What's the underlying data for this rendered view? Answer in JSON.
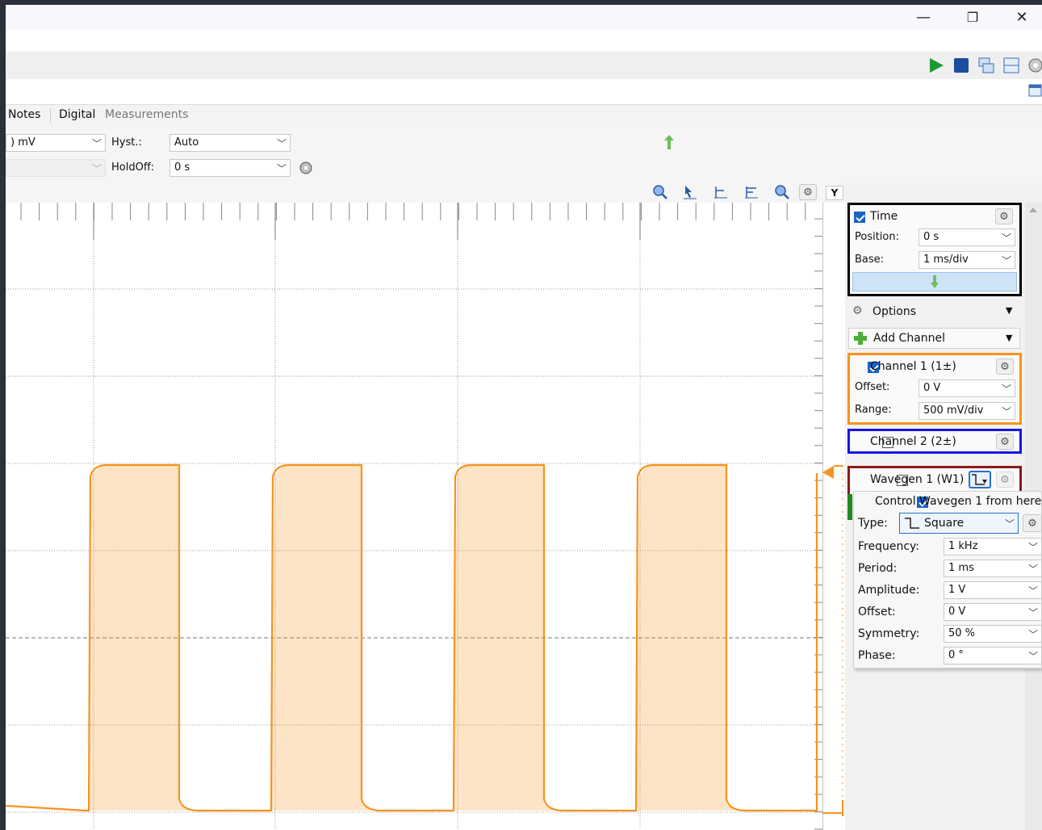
{
  "window": {
    "minimize_glyph": "—",
    "restore_glyph": "❐",
    "close_glyph": "✕"
  },
  "tabs": [
    {
      "label": "Notes",
      "active": true
    },
    {
      "label": "Digital",
      "active": true
    },
    {
      "label": "Measurements",
      "active": false
    }
  ],
  "trigger": {
    "level_value": ") mV",
    "hyst_label": "Hyst.:",
    "hyst_value": "Auto",
    "holdoff_label": "HoldOff:",
    "holdoff_value": "0 s"
  },
  "plot_toolbar": {
    "y_label": "Y",
    "icons": [
      "zoom-in-icon",
      "cursor-icon",
      "align-icon",
      "align-icon",
      "zoom-out-icon",
      "gear-icon"
    ]
  },
  "time_panel": {
    "label": "Time",
    "checked": true,
    "position_label": "Position:",
    "position_value": "0 s",
    "base_label": "Base:",
    "base_value": "1 ms/div"
  },
  "options": {
    "label": "Options"
  },
  "add_channel": {
    "label": "Add Channel"
  },
  "channel1": {
    "label": "Channel 1 (1±)",
    "checked": true,
    "offset_label": "Offset:",
    "offset_value": "0 V",
    "range_label": "Range:",
    "range_value": "500 mV/div",
    "color": "#f7931e"
  },
  "channel2": {
    "label": "Channel 2 (2±)",
    "checked": false,
    "color": "#1616e6"
  },
  "wavegen": {
    "label": "Wavegen 1 (W1)",
    "checked": false,
    "control_label": "Control Wavegen 1 from here",
    "control_checked": true,
    "type_label": "Type:",
    "type_value": "Square",
    "color": "#8b1a1a",
    "params": [
      {
        "label": "Frequency:",
        "value": "1 kHz"
      },
      {
        "label": "Period:",
        "value": "1 ms"
      },
      {
        "label": "Amplitude:",
        "value": "1 V"
      },
      {
        "label": "Offset:",
        "value": "0 V"
      },
      {
        "label": "Symmetry:",
        "value": "50 %"
      },
      {
        "label": "Phase:",
        "value": "0 °"
      }
    ]
  },
  "colors": {
    "trace": "#f7931e",
    "time_border": "#000000",
    "ch1_border": "#f7931e",
    "ch2_border": "#1616e6",
    "wavegen_border": "#8b1a1a",
    "run_green": "#1e9a2e",
    "stop_blue": "#1c4e9c"
  }
}
